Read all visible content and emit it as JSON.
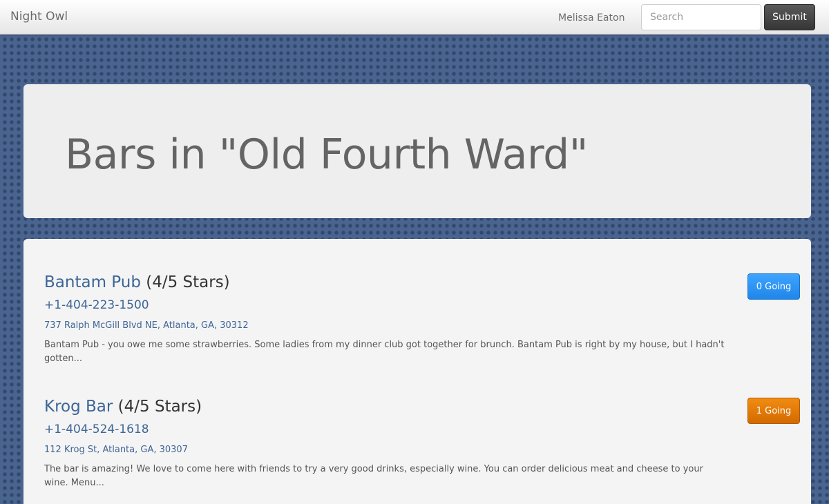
{
  "navbar": {
    "brand": "Night Owl",
    "user_name": "Melissa Eaton",
    "search_placeholder": "Search",
    "search_value": "",
    "submit_label": "Submit"
  },
  "jumbotron": {
    "heading": "Bars in \"Old Fourth Ward\""
  },
  "bars": [
    {
      "name": "Bantam Pub",
      "rating": "(4/5 Stars)",
      "phone": "+1-404-223-1500",
      "address": "737 Ralph McGill Blvd NE, Atlanta, GA, 30312",
      "snippet": "Bantam Pub - you owe me some strawberries. Some ladies from my dinner club got together for brunch. Bantam Pub is right by my house, but I hadn't gotten...",
      "going_label": "0 Going",
      "going_color": "#2b95f5"
    },
    {
      "name": "Krog Bar",
      "rating": "(4/5 Stars)",
      "phone": "+1-404-524-1618",
      "address": "112 Krog St, Atlanta, GA, 30307",
      "snippet": "The bar is amazing! We love to come here with friends to try a very good drinks, especially wine. You can order delicious meat and cheese to your wine. Menu...",
      "going_label": "1 Going",
      "going_color": "#e37a06"
    }
  ]
}
